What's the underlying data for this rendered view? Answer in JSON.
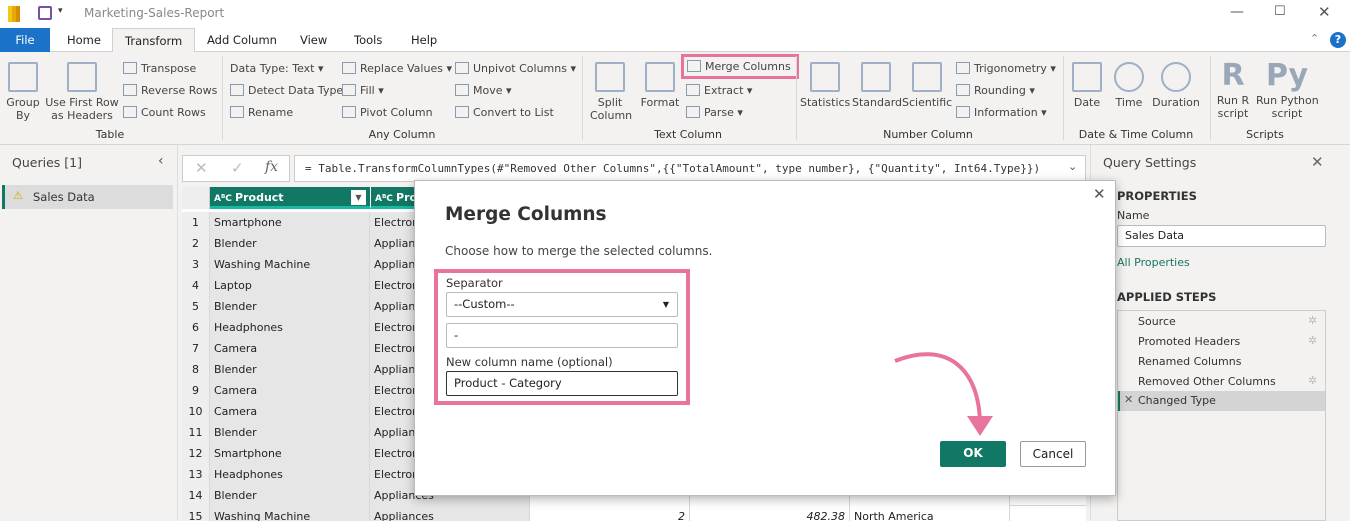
{
  "app": {
    "title": "Marketing-Sales-Report"
  },
  "tabs": [
    "File",
    "Home",
    "Transform",
    "Add Column",
    "View",
    "Tools",
    "Help"
  ],
  "ribbon": {
    "table": {
      "group_by": [
        "Group",
        "By"
      ],
      "first_row": [
        "Use First Row",
        "as Headers"
      ],
      "transpose": "Transpose",
      "reverse_rows": "Reverse Rows",
      "count_rows": "Count Rows",
      "label": "Table"
    },
    "any": {
      "data_type": "Data Type: Text",
      "detect": "Detect Data Type",
      "rename": "Rename",
      "replace": "Replace Values",
      "fill": "Fill",
      "pivot": "Pivot Column",
      "unpivot": "Unpivot Columns",
      "move": "Move",
      "convert": "Convert to List",
      "label": "Any Column"
    },
    "text": {
      "split": [
        "Split",
        "Column"
      ],
      "format": "Format",
      "merge": "Merge Columns",
      "extract": "Extract",
      "parse": "Parse",
      "label": "Text Column"
    },
    "number": {
      "statistics": "Statistics",
      "standard": "Standard",
      "scientific": "Scientific",
      "trig": "Trigonometry",
      "rounding": "Rounding",
      "information": "Information",
      "label": "Number Column"
    },
    "datetime": {
      "date": "Date",
      "time": "Time",
      "duration": "Duration",
      "label": "Date & Time Column"
    },
    "scripts": {
      "r": [
        "Run R",
        "script"
      ],
      "py": [
        "Run Python",
        "script"
      ],
      "label": "Scripts"
    }
  },
  "queries": {
    "title": "Queries [1]",
    "items": [
      "Sales Data"
    ]
  },
  "formula": "= Table.TransformColumnTypes(#\"Removed Other Columns\",{{\"TotalAmount\", type number}, {\"Quantity\", Int64.Type}})",
  "grid": {
    "headers": [
      "Product",
      "Pro"
    ],
    "rows": [
      [
        "1",
        "Smartphone",
        "Electron"
      ],
      [
        "2",
        "Blender",
        "Applianc"
      ],
      [
        "3",
        "Washing Machine",
        "Applianc"
      ],
      [
        "4",
        "Laptop",
        "Electron"
      ],
      [
        "5",
        "Blender",
        "Applianc"
      ],
      [
        "6",
        "Headphones",
        "Electron"
      ],
      [
        "7",
        "Camera",
        "Electron"
      ],
      [
        "8",
        "Blender",
        "Applianc"
      ],
      [
        "9",
        "Camera",
        "Electron"
      ],
      [
        "10",
        "Camera",
        "Electron"
      ],
      [
        "11",
        "Blender",
        "Applianc"
      ],
      [
        "12",
        "Smartphone",
        "Electron"
      ],
      [
        "13",
        "Headphones",
        "Electron"
      ],
      [
        "14",
        "Blender",
        "Appliances"
      ],
      [
        "15",
        "Washing Machine",
        "Appliances",
        "2",
        "482.38",
        "North America"
      ]
    ]
  },
  "settings": {
    "title": "Query Settings",
    "properties": "PROPERTIES",
    "name_label": "Name",
    "name_value": "Sales Data",
    "all_properties": "All Properties",
    "applied_steps": "APPLIED STEPS",
    "steps": [
      "Source",
      "Promoted Headers",
      "Renamed Columns",
      "Removed Other Columns",
      "Changed Type"
    ]
  },
  "dialog": {
    "title": "Merge Columns",
    "description": "Choose how to merge the selected columns.",
    "separator_label": "Separator",
    "separator_value": "--Custom--",
    "custom_value": "-",
    "new_name_label": "New column name (optional)",
    "new_name_value": "Product - Category",
    "ok": "OK",
    "cancel": "Cancel"
  },
  "colors": {
    "accent": "#117865",
    "highlight": "#e8739d",
    "file_tab": "#1a73c8"
  }
}
